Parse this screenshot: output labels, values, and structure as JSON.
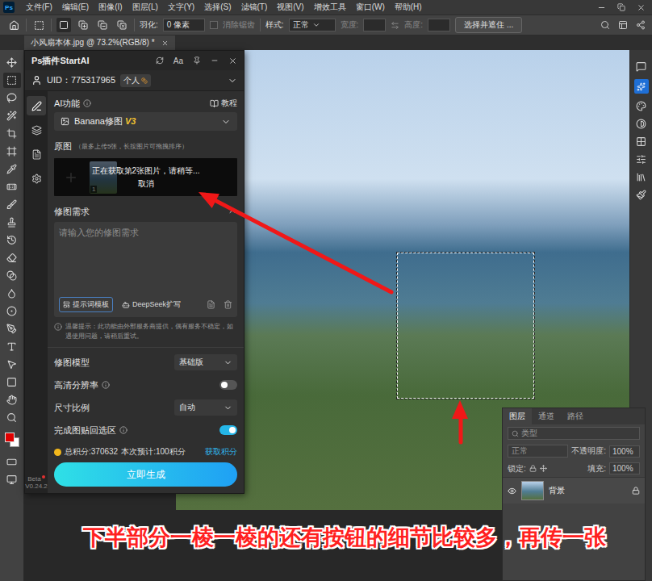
{
  "app": {
    "logo": "Ps",
    "menus": [
      "文件(F)",
      "编辑(E)",
      "图像(I)",
      "图层(L)",
      "文字(Y)",
      "选择(S)",
      "滤镜(T)",
      "视图(V)",
      "增效工具",
      "窗口(W)",
      "帮助(H)"
    ]
  },
  "options_bar": {
    "selection_modes": [
      {
        "selected": true
      },
      {
        "selected": false
      },
      {
        "selected": false
      },
      {
        "selected": false
      }
    ],
    "feather_label": "羽化:",
    "feather_value": "0 像素",
    "antialias": {
      "label": "消除锯齿",
      "disabled": true
    },
    "style_label": "样式:",
    "style_value": "正常",
    "width_label": "宽度:",
    "height_label": "高度:",
    "select_mask": "选择并遮住 ..."
  },
  "document_tab": {
    "title": "小风扇本体.jpg @ 73.2%(RGB/8) *"
  },
  "plugin": {
    "title": "Ps插件StartAI",
    "font_button": "Aa",
    "uid": "UID：775317965",
    "account_badge": "个人",
    "sidebar": [
      {
        "selected": true
      },
      {
        "selected": false
      },
      {
        "selected": false
      },
      {
        "selected": false
      }
    ],
    "ai_feature": {
      "label": "AI功能",
      "help": "教程"
    },
    "feature_select": {
      "name": "Banana修图",
      "version": "V3"
    },
    "source": {
      "label": "原图",
      "hint": "（最多上传5张，长按图片可拖拽排序）",
      "thumb_index": "1",
      "loading": "正在获取第2张图片，请稍等...",
      "cancel": "取消"
    },
    "prompt": {
      "label": "修图需求",
      "expanded": true,
      "placeholder": "请输入您的修图需求",
      "template_button": "提示词模板",
      "expand_button": "DeepSeek扩写"
    },
    "notice": "温馨提示：此功能由外部服务商提供，偶有服务不稳定，如遇使用问题，请稍后重试。",
    "settings": [
      {
        "kind": "select",
        "label": "修图模型",
        "value": "基础版",
        "info": false
      },
      {
        "kind": "toggle",
        "label": "高清分辨率",
        "on": false,
        "info": true
      },
      {
        "kind": "select",
        "label": "尺寸比例",
        "value": "自动",
        "info": false
      },
      {
        "kind": "toggle",
        "label": "完成图贴回选区",
        "on": true,
        "info": true
      }
    ],
    "credits": {
      "total": "总积分:370632",
      "estimate": "本次预计:100积分",
      "get": "获取积分"
    },
    "generate": "立即生成",
    "beta": "Beta",
    "version": "V0.24.2"
  },
  "layers_panel": {
    "tabs": [
      {
        "label": "图层",
        "selected": true
      },
      {
        "label": "通道",
        "selected": false
      },
      {
        "label": "路径",
        "selected": false
      }
    ],
    "filter_placeholder": "类型",
    "blend_mode": "正常",
    "opacity_label": "不透明度:",
    "opacity_value": "100%",
    "lock_label": "锁定:",
    "fill_label": "填充:",
    "fill_value": "100%",
    "layers": [
      {
        "name": "背景",
        "visible": true,
        "locked": true,
        "selected": false
      }
    ]
  },
  "caption": "下半部分一棱一棱的还有按钮的细节比较多，再传一张"
}
